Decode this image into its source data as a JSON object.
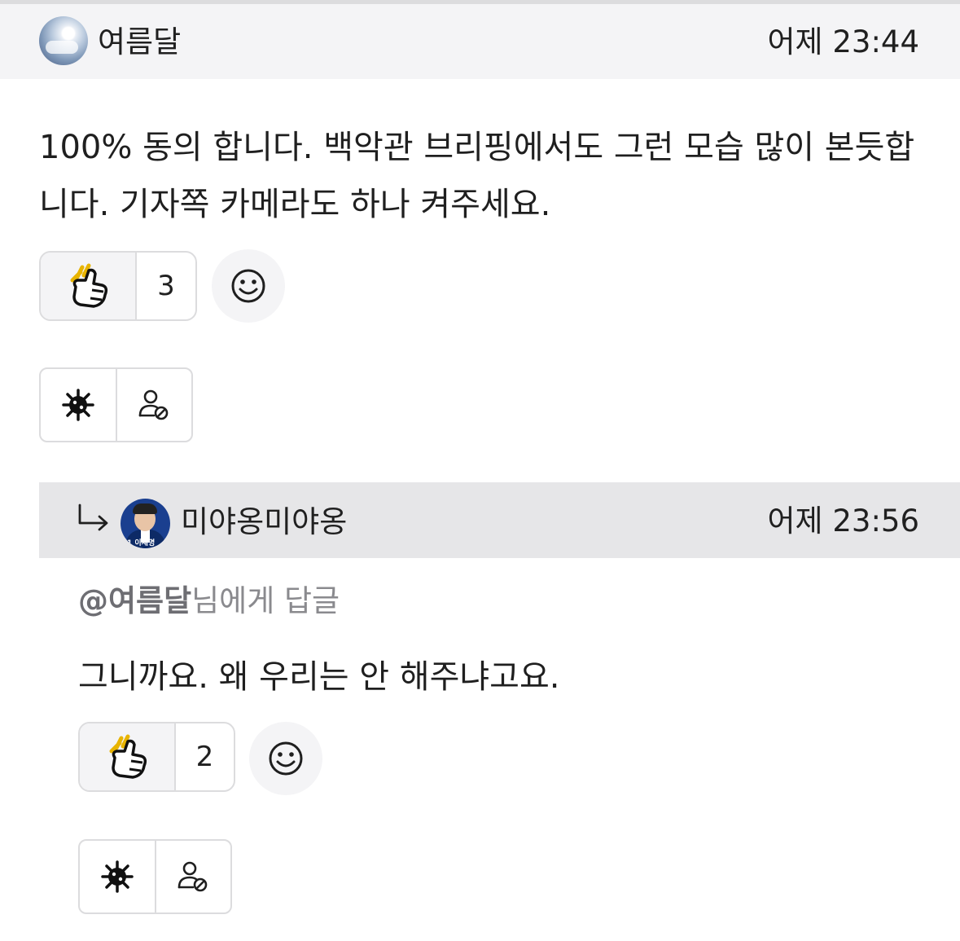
{
  "comment": {
    "author": "여름달",
    "time": "어제 23:44",
    "text": "100% 동의 합니다. 백악관 브리핑에서도 그런 모습 많이 본듯합니다. 기자쪽 카메라도 하나 켜주세요.",
    "reaction": {
      "icon": "thumbs-up-icon",
      "count": "3"
    },
    "actions": {
      "icons": [
        "virus-icon",
        "block-user-icon"
      ]
    }
  },
  "reply": {
    "author": "미야옹미야옹",
    "time": "어제 23:56",
    "mention_name": "@여름달",
    "mention_suffix": "님에게 답글",
    "text": "그니까요. 왜 우리는 안 해주냐고요.",
    "avatar_tag": "1 이재명",
    "reaction": {
      "icon": "thumbs-up-icon",
      "count": "2"
    },
    "actions": {
      "icons": [
        "virus-icon",
        "block-user-icon"
      ]
    }
  },
  "colors": {
    "header_bg": "#f4f4f6",
    "reply_header_bg": "#e6e6e8",
    "border": "#dcdcde",
    "mention_text": "#8a8a8e"
  }
}
